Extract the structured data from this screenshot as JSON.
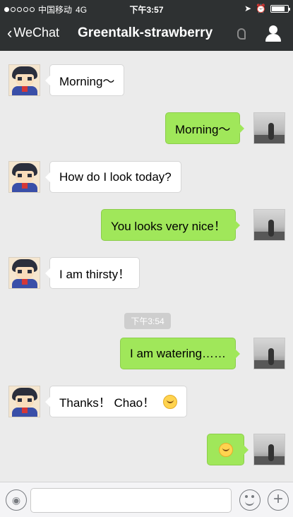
{
  "status": {
    "carrier": "中国移动",
    "network": "4G",
    "time": "下午3:57"
  },
  "nav": {
    "back_label": "WeChat",
    "title": "Greentalk-strawberry",
    "icons": [
      "back-chevron",
      "ear-icon",
      "person-icon"
    ]
  },
  "messages": [
    {
      "side": "in",
      "text": "Morning～"
    },
    {
      "side": "out",
      "text": "Morning～"
    },
    {
      "side": "in",
      "text": "How do I look today?"
    },
    {
      "side": "out",
      "text": "You looks very nice！"
    },
    {
      "side": "in",
      "text": "I am thirsty！"
    },
    {
      "side": "out",
      "text": "I am watering……"
    },
    {
      "side": "in",
      "text": "Thanks！ Chao！",
      "emoji": "smile-emoji-icon"
    },
    {
      "side": "out",
      "text": "",
      "emoji": "emoji-icon"
    }
  ],
  "timestamp": "下午3:54",
  "input": {
    "placeholder": "",
    "icons": [
      "voice-icon",
      "emoji-icon",
      "plus-icon"
    ]
  },
  "colors": {
    "bar": "#2e3132",
    "chat_background": "#ebebeb",
    "outgoing_bubble": "#a0e75a",
    "incoming_bubble": "#ffffff"
  }
}
